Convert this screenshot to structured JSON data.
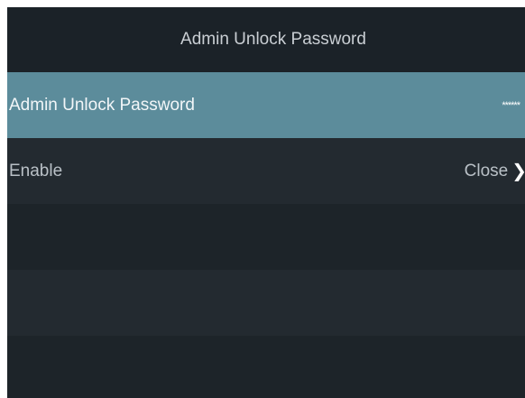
{
  "header": {
    "title": "Admin Unlock Password"
  },
  "settings": [
    {
      "label": "Admin Unlock Password",
      "value": "******"
    },
    {
      "label": "Enable",
      "value": "Close"
    }
  ],
  "icons": {
    "chevron": "chevron-right-icon"
  },
  "colors": {
    "background": "#1c2228",
    "selected_row": "#5c8c9b",
    "alt_row": "#232a30",
    "text": "#b9c0c6"
  }
}
